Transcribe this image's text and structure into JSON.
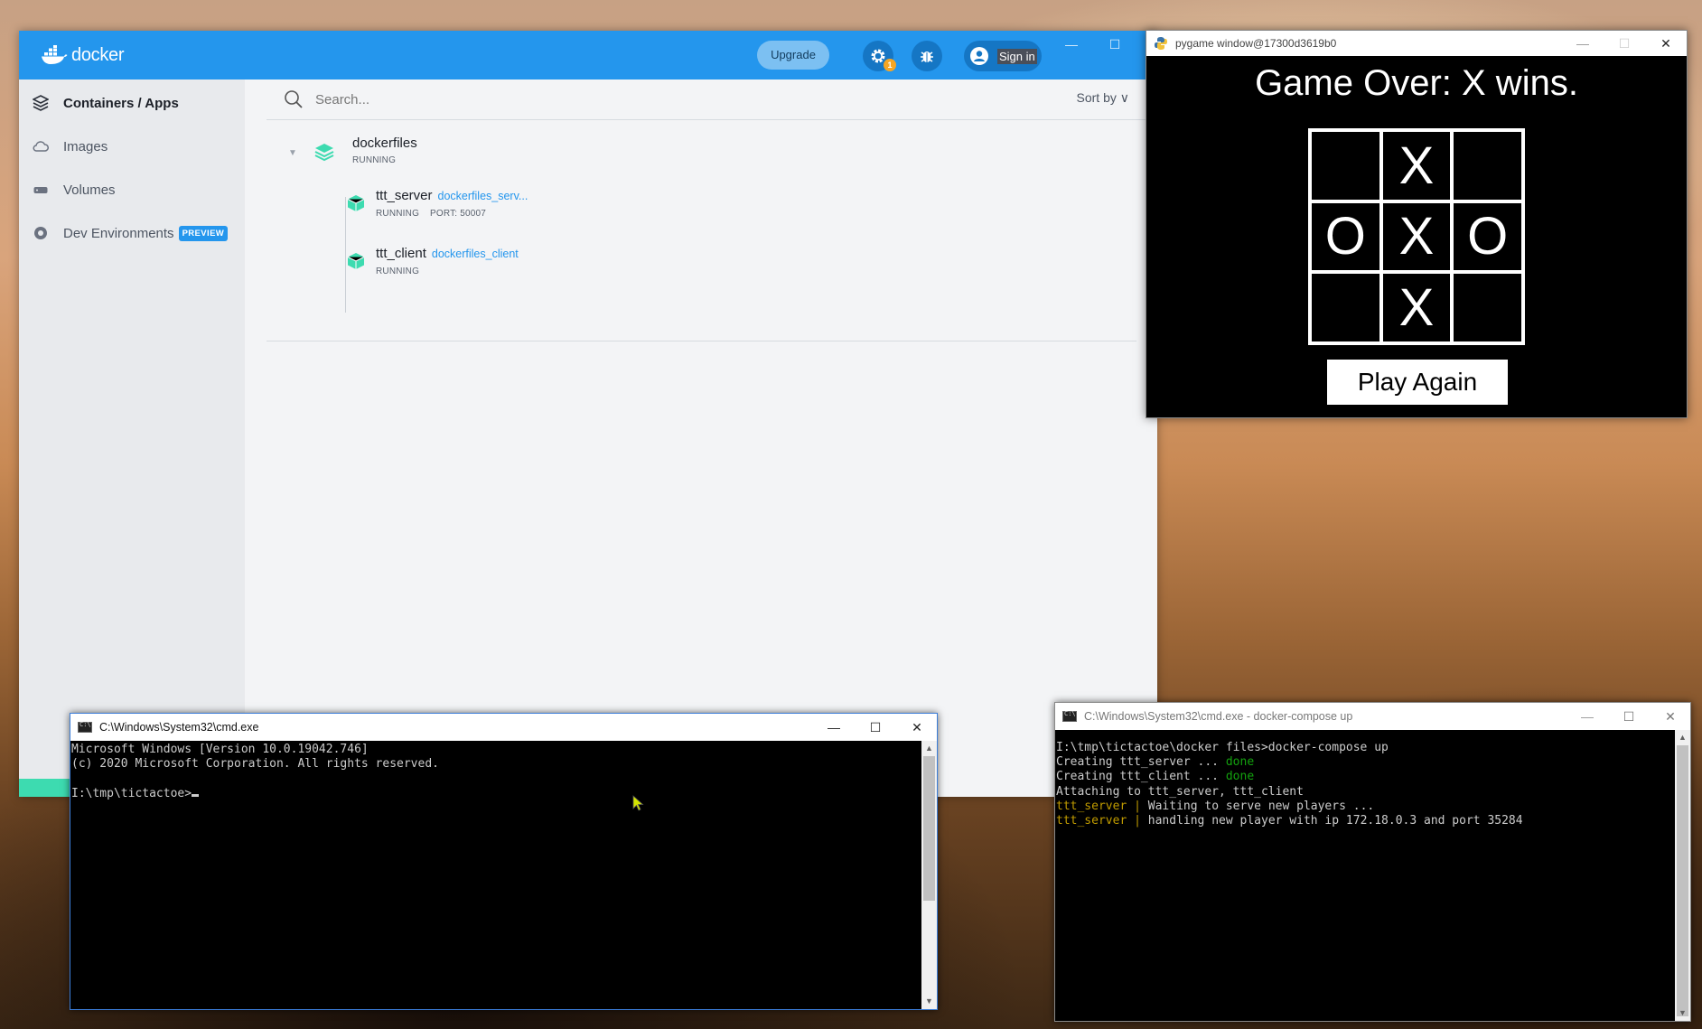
{
  "docker": {
    "brand": "docker",
    "upgrade_label": "Upgrade",
    "notification_count": "1",
    "signin_label": "Sign in",
    "window_controls": {
      "minimize": "—",
      "maximize": "☐",
      "close": "✕"
    },
    "sidebar": {
      "items": [
        {
          "label": "Containers / Apps",
          "icon": "containers-icon",
          "active": true
        },
        {
          "label": "Images",
          "icon": "cloud-icon"
        },
        {
          "label": "Volumes",
          "icon": "volume-icon"
        },
        {
          "label": "Dev Environments",
          "icon": "dev-env-icon",
          "badge": "PREVIEW"
        }
      ]
    },
    "search": {
      "placeholder": "Search..."
    },
    "sort_label": "Sort by",
    "app": {
      "name": "dockerfiles",
      "status": "RUNNING",
      "containers": [
        {
          "name": "ttt_server",
          "image": "dockerfiles_serv...",
          "status": "RUNNING",
          "port": "PORT: 50007"
        },
        {
          "name": "ttt_client",
          "image": "dockerfiles_client",
          "status": "RUNNING"
        }
      ]
    },
    "colors": {
      "brand": "#2496ed",
      "running": "#3ddbb0"
    }
  },
  "pygame": {
    "title": "pygame window@17300d3619b0",
    "status": "Game Over: X wins.",
    "board": [
      "",
      "X",
      "",
      "O",
      "X",
      "O",
      "",
      "X",
      ""
    ],
    "play_again_label": "Play Again"
  },
  "cmd1": {
    "title": "C:\\Windows\\System32\\cmd.exe",
    "lines": [
      "Microsoft Windows [Version 10.0.19042.746]",
      "(c) 2020 Microsoft Corporation. All rights reserved.",
      "",
      "I:\\tmp\\tictactoe>"
    ]
  },
  "cmd2": {
    "title": "C:\\Windows\\System32\\cmd.exe - docker-compose  up",
    "prompt_line": "I:\\tmp\\tictactoe\\docker files>docker-compose up",
    "creating": [
      {
        "text": "Creating ttt_server ... ",
        "result": "done"
      },
      {
        "text": "Creating ttt_client ... ",
        "result": "done"
      }
    ],
    "attaching": "Attaching to ttt_server, ttt_client",
    "logs": [
      {
        "service": "ttt_server",
        "sep": " | ",
        "message": "Waiting to serve new players ..."
      },
      {
        "service": "ttt_server",
        "sep": " | ",
        "message": "handling new player with ip 172.18.0.3 and port 35284"
      }
    ]
  }
}
